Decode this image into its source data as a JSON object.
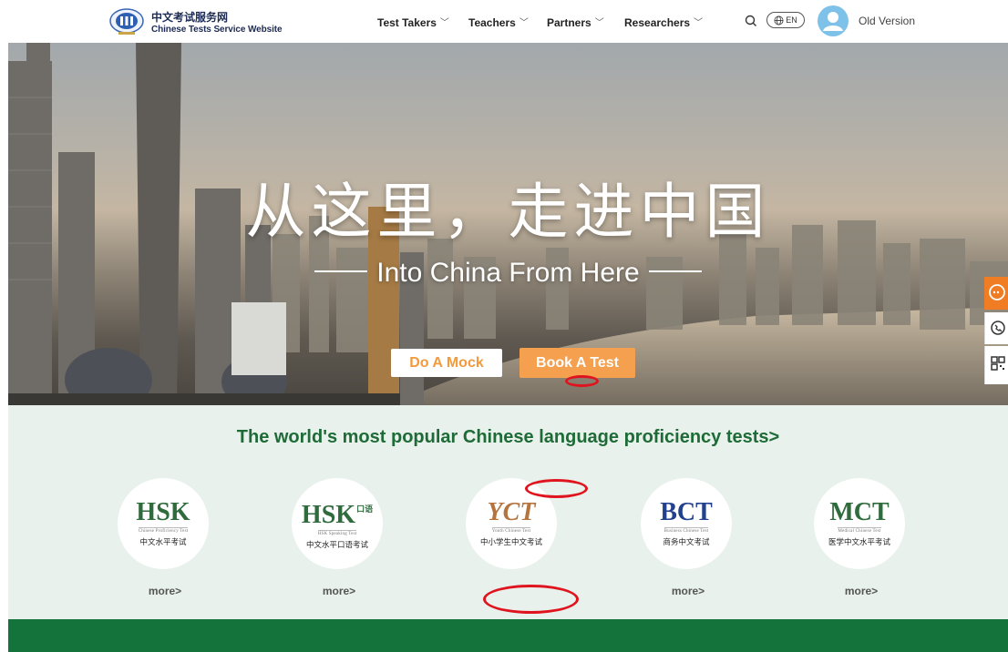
{
  "header": {
    "logo_cn": "中文考试服务网",
    "logo_en": "Chinese Tests Service Website",
    "nav": [
      {
        "label": "Test Takers"
      },
      {
        "label": "Teachers"
      },
      {
        "label": "Partners"
      },
      {
        "label": "Researchers"
      }
    ],
    "search_icon": "search-icon",
    "language": "EN",
    "old_version": "Old Version"
  },
  "hero": {
    "title_cn": "从这里，走进中国",
    "subtitle": "Into China From Here",
    "btn_mock": "Do A Mock",
    "btn_book": "Book A Test"
  },
  "tests": {
    "heading": "The world's most popular Chinese language proficiency tests>",
    "items": [
      {
        "logo": "HSK",
        "logo_sup": "",
        "en": "Chinese Proficiency Test",
        "cn": "中文水平考试",
        "more": "more>",
        "color": "#2f6b3c"
      },
      {
        "logo": "HSK",
        "logo_sup": "口语",
        "en": "HSK Speaking Test",
        "cn": "中文水平口语考试",
        "more": "more>",
        "color": "#2f6b3c"
      },
      {
        "logo": "YCT",
        "logo_sup": "",
        "en": "Youth Chinese Test",
        "cn": "中小学生中文考试",
        "more": "",
        "color": "#b5733d"
      },
      {
        "logo": "BCT",
        "logo_sup": "",
        "en": "Business Chinese Test",
        "cn": "商务中文考试",
        "more": "more>",
        "color": "#23418c"
      },
      {
        "logo": "MCT",
        "logo_sup": "",
        "en": "Medical Chinese Test",
        "cn": "医学中文水平考试",
        "more": "more>",
        "color": "#2f6b3c"
      }
    ]
  },
  "colors": {
    "brand_green": "#1e6b37",
    "footer_green": "#13733a",
    "accent_orange": "#f4a04e",
    "annotation_red": "#e0141e"
  }
}
